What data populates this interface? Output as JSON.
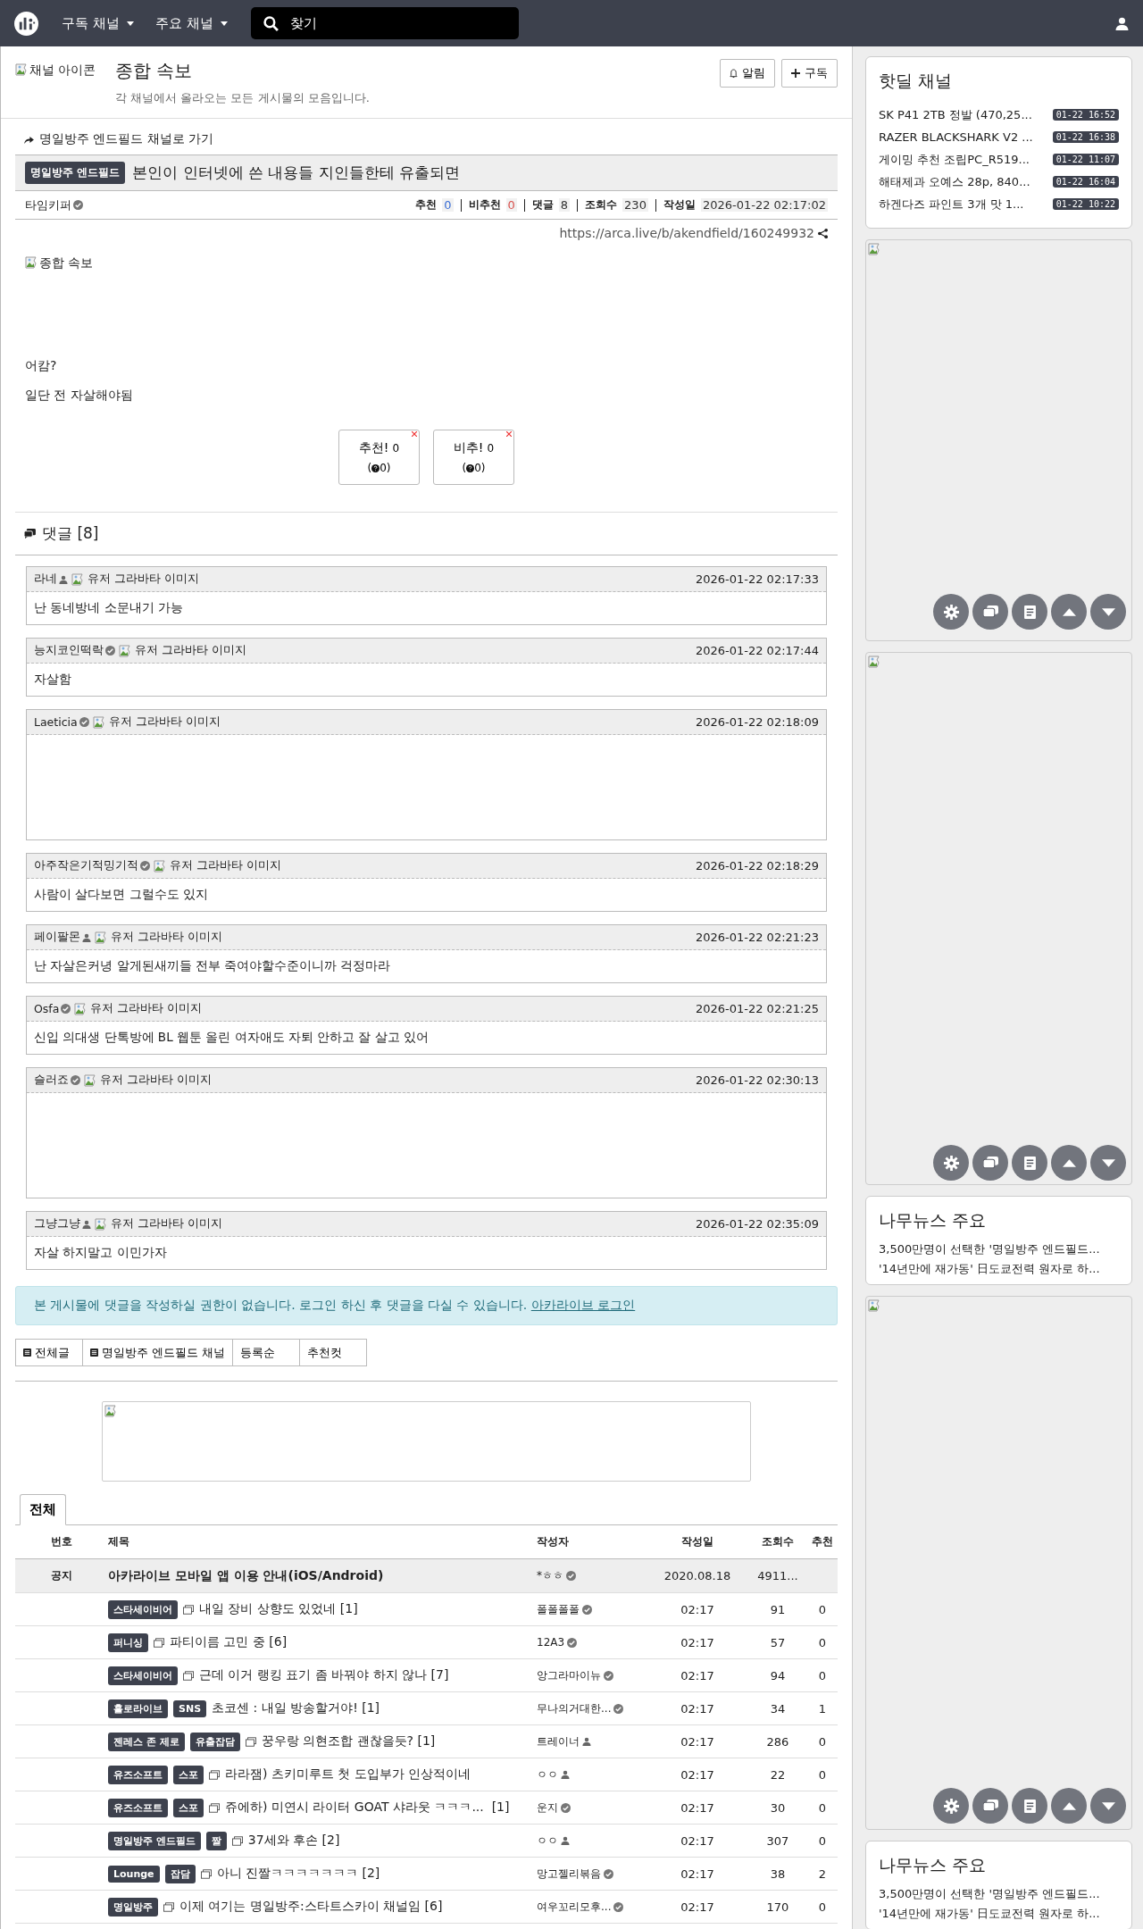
{
  "nav": {
    "menus": [
      {
        "label": "구독 채널"
      },
      {
        "label": "주요 채널"
      }
    ],
    "search": {
      "placeholder": "찾기"
    }
  },
  "channel": {
    "icon_alt": "채널 아이콘",
    "title": "종합 속보",
    "description": "각 채널에서 올라오는 모든 게시물의 모음입니다.",
    "buttons": [
      {
        "label": "알림",
        "kind": "bell"
      },
      {
        "label": "구독",
        "kind": "plus"
      }
    ]
  },
  "post": {
    "back_link": "명일방주 엔드필드 채널로 가기",
    "category": "명일방주 엔드필드",
    "title": "본인이 인터넷에 쓴 내용들 지인들한테 유출되면",
    "author": "타임키퍼",
    "verified": true,
    "stats": [
      {
        "label": "추천",
        "value": "0",
        "color": "#3b6fd6"
      },
      {
        "label": "비추천",
        "value": "0",
        "color": "#d9534f"
      },
      {
        "label": "댓글",
        "value": "8",
        "color": "#333333"
      },
      {
        "label": "조회수",
        "value": "230",
        "color": "#333333"
      },
      {
        "label": "작성일",
        "value": "2026-01-22 02:17:02",
        "color": "#333333"
      }
    ],
    "url": "https://arca.live/b/akendfield/160249932",
    "image_alt": "종합 속보",
    "body": [
      "어캄?",
      "일단 전 자살해야됨"
    ],
    "votes": [
      {
        "label": "추천!",
        "count": "0",
        "sub_open": "(",
        "sub": "0)"
      },
      {
        "label": "비추!",
        "count": "0",
        "sub_open": "(",
        "sub": "0)"
      }
    ]
  },
  "comments": {
    "title": "댓글 [8]",
    "items": [
      {
        "author": "라네",
        "verified": false,
        "avatar_alt": "유저 그라바타 이미지",
        "time": "2026-01-22 02:17:33",
        "kind": "text",
        "text": "난 동네방네 소문내기 가능"
      },
      {
        "author": "능지코인떡락",
        "verified": true,
        "avatar_alt": "유저 그라바타 이미지",
        "time": "2026-01-22 02:17:44",
        "kind": "text",
        "text": "자살함"
      },
      {
        "author": "Laeticia",
        "verified": true,
        "avatar_alt": "유저 그라바타 이미지",
        "time": "2026-01-22 02:18:09",
        "kind": "emoticon"
      },
      {
        "author": "아주작은기적밍기적",
        "verified": true,
        "avatar_alt": "유저 그라바타 이미지",
        "time": "2026-01-22 02:18:29",
        "kind": "text",
        "text": "사람이 살다보면 그럴수도 있지"
      },
      {
        "author": "페이팔몬",
        "verified": false,
        "avatar_alt": "유저 그라바타 이미지",
        "time": "2026-01-22 02:21:23",
        "kind": "text",
        "text": "난 자살은커녕 알게된새끼들 전부 죽여야할수준이니까 걱정마라"
      },
      {
        "author": "Osfa",
        "verified": true,
        "avatar_alt": "유저 그라바타 이미지",
        "time": "2026-01-22 02:21:25",
        "kind": "text",
        "text": "신입 의대생 단톡방에 BL 웹툰 올린 여자애도 자퇴 안하고 잘 살고 있어"
      },
      {
        "author": "슬러죠",
        "verified": true,
        "avatar_alt": "유저 그라바타 이미지",
        "time": "2026-01-22 02:30:13",
        "kind": "emoticon"
      },
      {
        "author": "그냥그냥",
        "verified": false,
        "avatar_alt": "유저 그라바타 이미지",
        "time": "2026-01-22 02:35:09",
        "kind": "text",
        "text": "자살 하지말고 이민가자"
      }
    ]
  },
  "login_notice": {
    "text": "본 게시물에 댓글을 작성하실 권한이 없습니다. 로그인 하신 후 댓글을 다실 수 있습니다.",
    "link": "아카라이브 로그인"
  },
  "filter_tabs": [
    {
      "label": "전체글",
      "icon": true
    },
    {
      "label": "명일방주 엔드필드 채널",
      "icon": true
    },
    {
      "label": "등록순",
      "icon": false
    },
    {
      "label": "추천컷",
      "icon": false
    }
  ],
  "board": {
    "tabs": [
      {
        "label": "전체",
        "selected": true
      }
    ],
    "columns": [
      "번호",
      "제목",
      "작성자",
      "작성일",
      "조회수",
      "추천"
    ],
    "rows": [
      {
        "kind": "notice",
        "number": "공지",
        "tags": [],
        "gallery": false,
        "title": "아카라이브 모바일 앱 이용 안내(iOS/Android)",
        "author": "*ㅎㅎ",
        "verified": true,
        "date": "2020.08.18",
        "views": "4911...",
        "likes": ""
      },
      {
        "kind": "post",
        "tags": [
          "스타세이비어"
        ],
        "gallery": true,
        "title": "내일 장비 상향도 있었네 [1]",
        "author": "폴폴폴폴",
        "verified": true,
        "date": "02:17",
        "views": "91",
        "likes": "0"
      },
      {
        "kind": "post",
        "tags": [
          "퍼니싱"
        ],
        "gallery": true,
        "title": "파티이름 고민 중 [6]",
        "author": "12A3",
        "verified": true,
        "date": "02:17",
        "views": "57",
        "likes": "0"
      },
      {
        "kind": "post",
        "tags": [
          "스타세이비어"
        ],
        "gallery": true,
        "title": "근데 이거 랭킹 표기 좀 바꿔야 하지 않나 [7]",
        "author": "앙그라마이뉴",
        "verified": true,
        "date": "02:17",
        "views": "94",
        "likes": "0"
      },
      {
        "kind": "post",
        "tags": [
          "홀로라이브",
          "SNS"
        ],
        "gallery": false,
        "title": "초코센 : 내일 방송할거야! [1]",
        "author": "무나의거대한...",
        "verified": true,
        "date": "02:17",
        "views": "34",
        "likes": "1"
      },
      {
        "kind": "post",
        "tags": [
          "젠레스 존 제로",
          "유출잡담"
        ],
        "gallery": true,
        "title": "꿍우랑 의현조합 괜찮을듯? [1]",
        "author": "트레이너",
        "verified": false,
        "date": "02:17",
        "views": "286",
        "likes": "0"
      },
      {
        "kind": "post",
        "tags": [
          "유즈소프트",
          "스포"
        ],
        "gallery": true,
        "title": "라라잼) 츠키미루트 첫 도입부가 인상적이네",
        "author": "ㅇㅇ",
        "verified": false,
        "date": "02:17",
        "views": "22",
        "likes": "0"
      },
      {
        "kind": "post",
        "tags": [
          "유즈소프트",
          "스포"
        ],
        "gallery": true,
        "title": "쥬에하) 미연시 라이터 GOAT 샤라웃 ㅋㅋㅋ...  [1]",
        "author": "운지",
        "verified": true,
        "date": "02:17",
        "views": "30",
        "likes": "0"
      },
      {
        "kind": "post",
        "tags": [
          "명일방주 엔드필드",
          "짤"
        ],
        "gallery": true,
        "title": "37세와 후손 [2]",
        "author": "ㅇㅇ",
        "verified": false,
        "date": "02:17",
        "views": "307",
        "likes": "0"
      },
      {
        "kind": "post",
        "tags": [
          "Lounge",
          "잡담"
        ],
        "gallery": true,
        "title": "아니 진짤ㅋㅋㅋㅋㅋㅋㅋ [2]",
        "author": "망고젤리볶음",
        "verified": true,
        "date": "02:17",
        "views": "38",
        "likes": "2"
      },
      {
        "kind": "post",
        "tags": [
          "명일방주"
        ],
        "gallery": true,
        "title": "이제 여기는 명일방주:스타트스카이 채널임 [6]",
        "author": "여우꼬리모후...",
        "verified": true,
        "date": "02:17",
        "views": "170",
        "likes": "0"
      }
    ]
  },
  "sidebar": {
    "hotdeal": {
      "title": "핫딜 채널",
      "items": [
        {
          "title": "SK P41 2TB 정발 (470,25...",
          "time": "01-22 16:52"
        },
        {
          "title": "RAZER BLACKSHARK V2 ...",
          "time": "01-22 16:38"
        },
        {
          "title": "게이밍 추천 조립PC_R519...",
          "time": "01-22 11:07"
        },
        {
          "title": "해태제과 오예스 28p, 840...",
          "time": "01-22 16:04"
        },
        {
          "title": "하겐다즈 파인트 3개 맛 1...",
          "time": "01-22 10:22"
        }
      ]
    },
    "news": [
      {
        "title": "나무뉴스 주요",
        "items": [
          "3,500만명이 선택한 '명일방주 엔드필드...",
          "'14년만에 재가동' 日도쿄전력 원자로 하..."
        ]
      },
      {
        "title": "나무뉴스 주요",
        "items": [
          "3,500만명이 선택한 '명일방주 엔드필드...",
          "'14년만에 재가동' 日도쿄전력 원자로 하..."
        ]
      }
    ]
  }
}
